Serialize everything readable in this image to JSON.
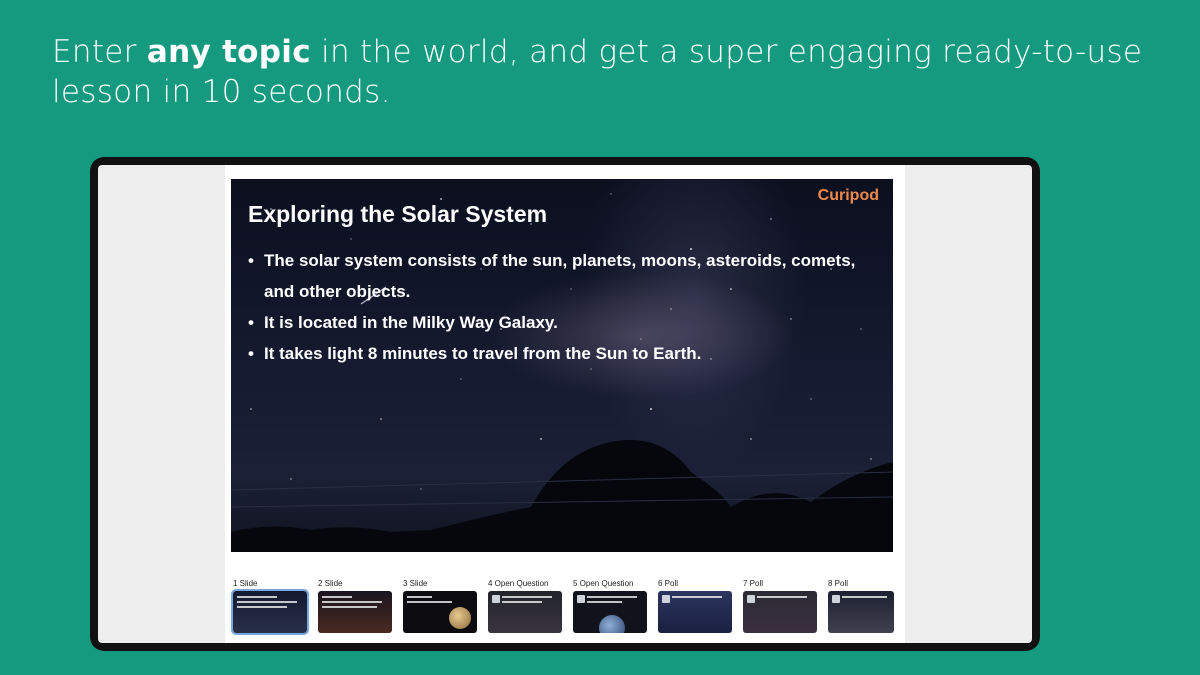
{
  "headline": {
    "prefix": "Enter ",
    "bold": "any topic",
    "suffix": " in the world, and get a super engaging ready-to-use lesson in 10 seconds."
  },
  "slide": {
    "brand": "Curipod",
    "title": "Exploring the Solar System",
    "bullets": [
      "The solar system consists of the sun, planets, moons, asteroids, comets, and other objects.",
      "It is located in the Milky Way Galaxy.",
      "It takes light 8 minutes to travel from the Sun to Earth."
    ]
  },
  "thumbnails": [
    {
      "label": "1 Slide"
    },
    {
      "label": "2 Slide"
    },
    {
      "label": "3 Slide"
    },
    {
      "label": "4 Open Question"
    },
    {
      "label": "5 Open Question"
    },
    {
      "label": "6 Poll"
    },
    {
      "label": "7 Poll"
    },
    {
      "label": "8 Poll"
    }
  ],
  "colors": {
    "background": "#169a7f",
    "brand": "#f08a4b",
    "active_outline": "#7aa7e0"
  }
}
